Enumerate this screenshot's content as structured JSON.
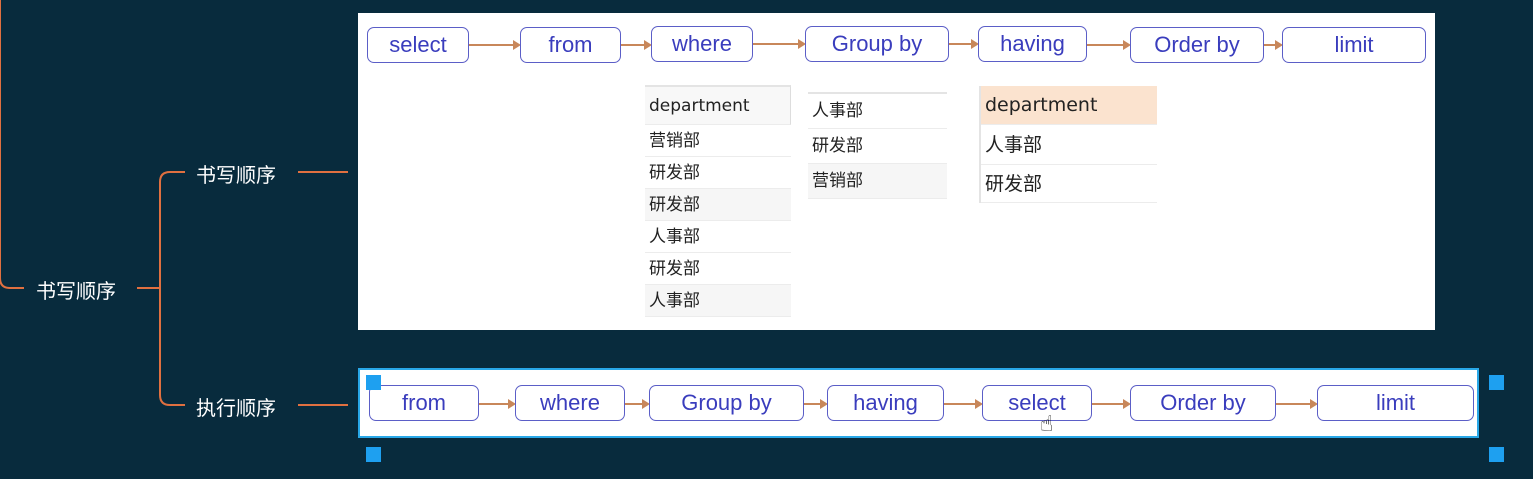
{
  "mindmap": {
    "root_label": "书写顺序",
    "branch_writing_label": "书写顺序",
    "branch_execution_label": "执行顺序"
  },
  "writing_order": [
    "select",
    "from",
    "where",
    "Group by",
    "having",
    "Order by",
    "limit"
  ],
  "execution_order": [
    "from",
    "where",
    "Group by",
    "having",
    "select",
    "Order by",
    "limit"
  ],
  "table_raw": {
    "header": "department",
    "rows": [
      "营销部",
      "研发部",
      "研发部",
      "人事部",
      "研发部",
      "人事部"
    ]
  },
  "table_grouped": {
    "rows": [
      "人事部",
      "研发部",
      "营销部"
    ]
  },
  "table_result": {
    "header": "department",
    "rows": [
      "人事部",
      "研发部"
    ]
  },
  "colors": {
    "background": "#082b3d",
    "connector": "#e07040",
    "node_border": "#5b5ec7",
    "node_text": "#3a3dbd",
    "arrow": "#c8875a",
    "selection": "#29a8e8"
  }
}
